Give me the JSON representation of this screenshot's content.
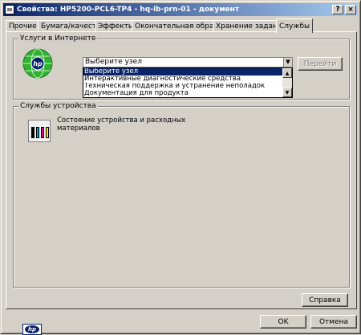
{
  "window": {
    "title": "Свойства: HP5200-PCL6-TP4 - hq-ib-prn-01 - документ",
    "help_label": "?",
    "close_label": "×"
  },
  "tabs": [
    {
      "label": "Прочие"
    },
    {
      "label": "Бумага/качество"
    },
    {
      "label": "Эффекты"
    },
    {
      "label": "Окончательная обработка"
    },
    {
      "label": "Хранение заданий"
    },
    {
      "label": "Службы"
    }
  ],
  "internet_services": {
    "group_label": "Услуги в Интернете",
    "combo_value": "Выберите узел",
    "dropdown_options": [
      "Выберите узел",
      "Интерактивные диагностические средства",
      "Техническая поддержка и устранение неполадок",
      "Документация для продукта"
    ],
    "go_button": "Перейти"
  },
  "device_services": {
    "group_label": "Службы устройства",
    "status_link": "Состояние устройства и расходных материалов"
  },
  "footer": {
    "help_button": "Справка",
    "ok_button": "OK",
    "cancel_button": "Отмена",
    "logo_text": "hp"
  },
  "colors": {
    "titlebar_start": "#0a246a",
    "titlebar_end": "#a6caf0",
    "selection": "#0a246a",
    "globe_green": "#2fb22f"
  }
}
